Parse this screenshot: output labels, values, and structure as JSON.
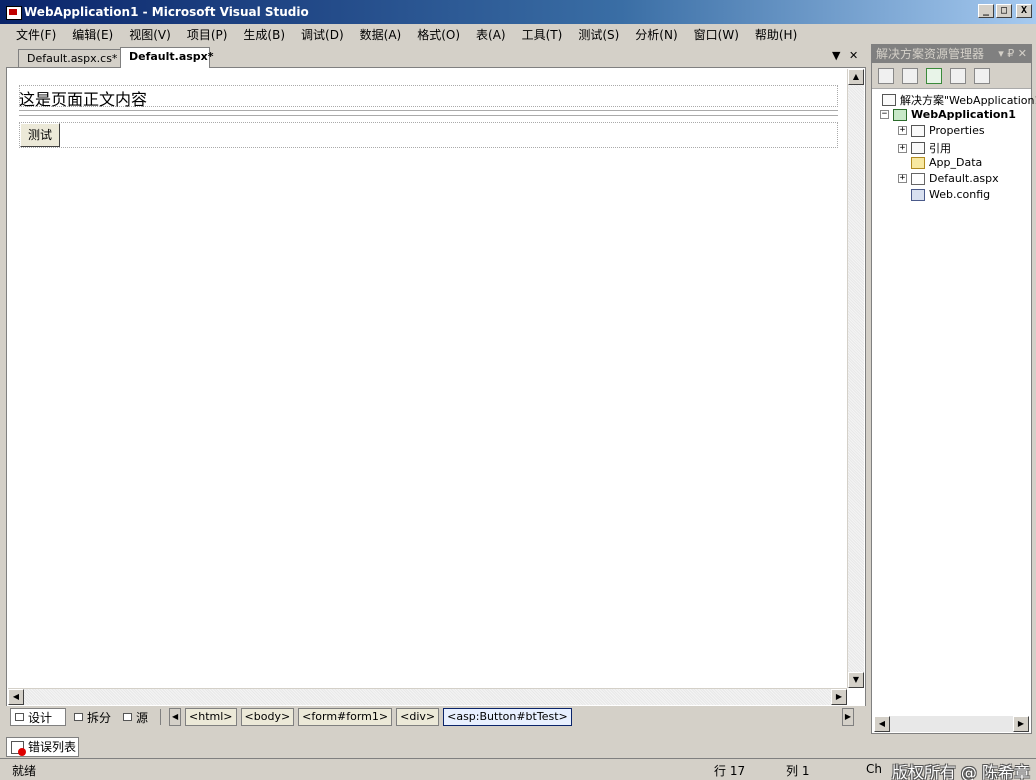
{
  "window": {
    "title": "WebApplication1 - Microsoft Visual Studio",
    "minimize": "_",
    "maximize": "□",
    "close": "X"
  },
  "menu": [
    "文件(F)",
    "编辑(E)",
    "视图(V)",
    "项目(P)",
    "生成(B)",
    "调试(D)",
    "数据(A)",
    "格式(O)",
    "表(A)",
    "工具(T)",
    "测试(S)",
    "分析(N)",
    "窗口(W)",
    "帮助(H)"
  ],
  "tabs": {
    "inactive": "Default.aspx.cs*",
    "active": "Default.aspx*",
    "dropdown": "▼",
    "close": "✕"
  },
  "design": {
    "body_text": "这是页面正文内容",
    "button_label": "测试"
  },
  "viewbar": {
    "design": "设计",
    "split": "拆分",
    "source": "源",
    "crumbs": [
      "<html>",
      "<body>",
      "<form#form1>",
      "<div>",
      "<asp:Button#btTest>"
    ]
  },
  "solution_explorer": {
    "title": "解决方案资源管理器",
    "controls": "▾ ₽ ✕",
    "solution": "解决方案\"WebApplication1",
    "project": "WebApplication1",
    "items": [
      "Properties",
      "引用",
      "App_Data",
      "Default.aspx",
      "Web.config"
    ]
  },
  "error_list": "错误列表",
  "status": {
    "ready": "就绪",
    "row": "行 17",
    "col": "列 1",
    "ch": "Ch",
    "watermark": "版权所有 @ 陈希章"
  }
}
